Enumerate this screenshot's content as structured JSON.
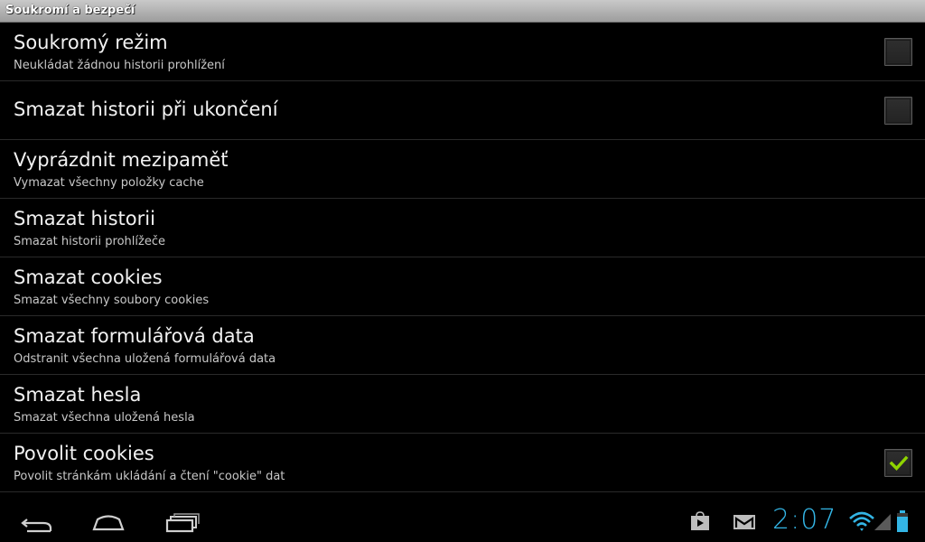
{
  "window": {
    "title": "Soukromí a bezpečí"
  },
  "settings": [
    {
      "title": "Soukromý režim",
      "summary": "Neukládat žádnou historii prohlížení",
      "has_checkbox": true,
      "checked": false
    },
    {
      "title": "Smazat historii při ukončení",
      "summary": "",
      "has_checkbox": true,
      "checked": false
    },
    {
      "title": "Vyprázdnit mezipaměť",
      "summary": "Vymazat všechny položky cache",
      "has_checkbox": false,
      "checked": false
    },
    {
      "title": "Smazat historii",
      "summary": "Smazat historii prohlížeče",
      "has_checkbox": false,
      "checked": false
    },
    {
      "title": "Smazat cookies",
      "summary": "Smazat všechny soubory cookies",
      "has_checkbox": false,
      "checked": false
    },
    {
      "title": "Smazat formulářová data",
      "summary": "Odstranit všechna uložená formulářová data",
      "has_checkbox": false,
      "checked": false
    },
    {
      "title": "Smazat hesla",
      "summary": "Smazat všechna uložená hesla",
      "has_checkbox": false,
      "checked": false
    },
    {
      "title": "Povolit cookies",
      "summary": "Povolit stránkám ukládání a čtení \"cookie\" dat",
      "has_checkbox": true,
      "checked": true
    }
  ],
  "navbar": {
    "buttons": [
      "back-icon",
      "home-icon",
      "recent-apps-icon"
    ]
  },
  "status_bar": {
    "clock": "2:07",
    "notifications": [
      "play-store-icon",
      "gmail-icon"
    ],
    "indicators": [
      "wifi-icon",
      "signal-icon",
      "battery-icon"
    ],
    "accent_color": "#33b5e5",
    "check_color": "#8fd400"
  }
}
